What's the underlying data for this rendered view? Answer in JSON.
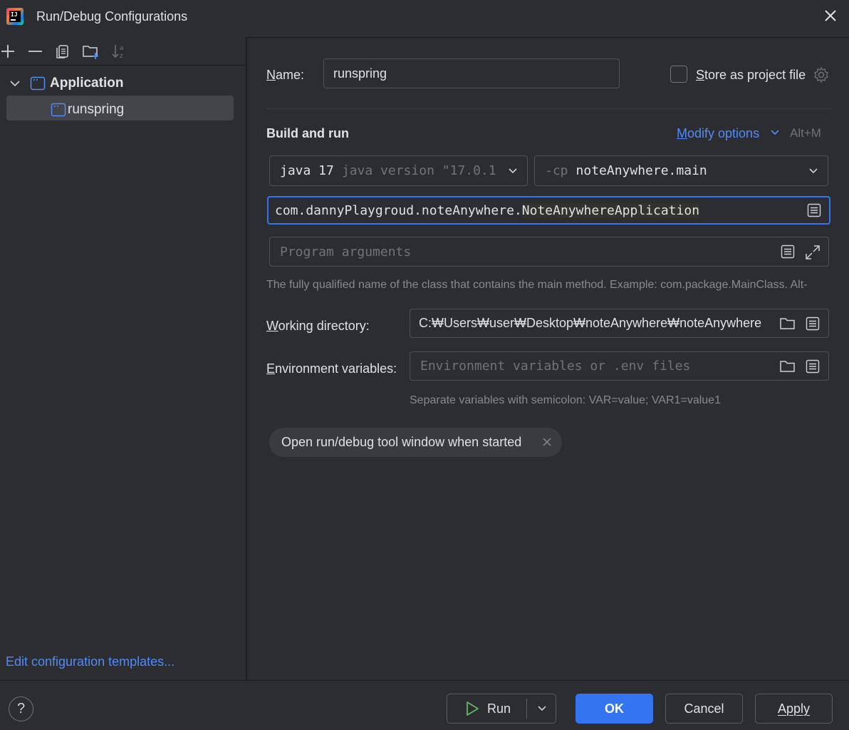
{
  "window": {
    "title": "Run/Debug Configurations"
  },
  "sidebar": {
    "tree": {
      "group_label": "Application",
      "items": [
        {
          "label": "runspring",
          "selected": true
        }
      ]
    },
    "footer_link": "Edit configuration templates..."
  },
  "form": {
    "name_label": "Name:",
    "name_value": "runspring",
    "store_label": "Store as project file",
    "store_checked": false,
    "section_title": "Build and run",
    "modify_options_label": "Modify options",
    "modify_options_shortcut": "Alt+M",
    "jdk": {
      "version": "java 17",
      "detail": "java version \"17.0.1"
    },
    "classpath": {
      "flag": "-cp",
      "module": "noteAnywhere.main"
    },
    "main_class": {
      "prefix": "com.dannyPlaygroud.noteAnywhere.",
      "highlight": "NoteAnywhereApplication"
    },
    "program_args_placeholder": "Program arguments",
    "main_class_hint": "The fully qualified name of the class that contains the main method. Example: com.package.MainClass. Alt-",
    "working_dir_label": "Working directory:",
    "working_dir_value": "C:₩Users₩user₩Desktop₩noteAnywhere₩noteAnywhere",
    "env_label": "Environment variables:",
    "env_placeholder": "Environment variables or .env files",
    "env_hint": "Separate variables with semicolon: VAR=value; VAR1=value1",
    "chip_label": "Open run/debug tool window when started"
  },
  "footer": {
    "help_label": "?",
    "run_label": "Run",
    "ok_label": "OK",
    "cancel_label": "Cancel",
    "apply_label": "Apply"
  },
  "colors": {
    "background": "#2b2d30",
    "accent": "#3574f0",
    "link": "#548af7",
    "run_green": "#5fb865"
  }
}
